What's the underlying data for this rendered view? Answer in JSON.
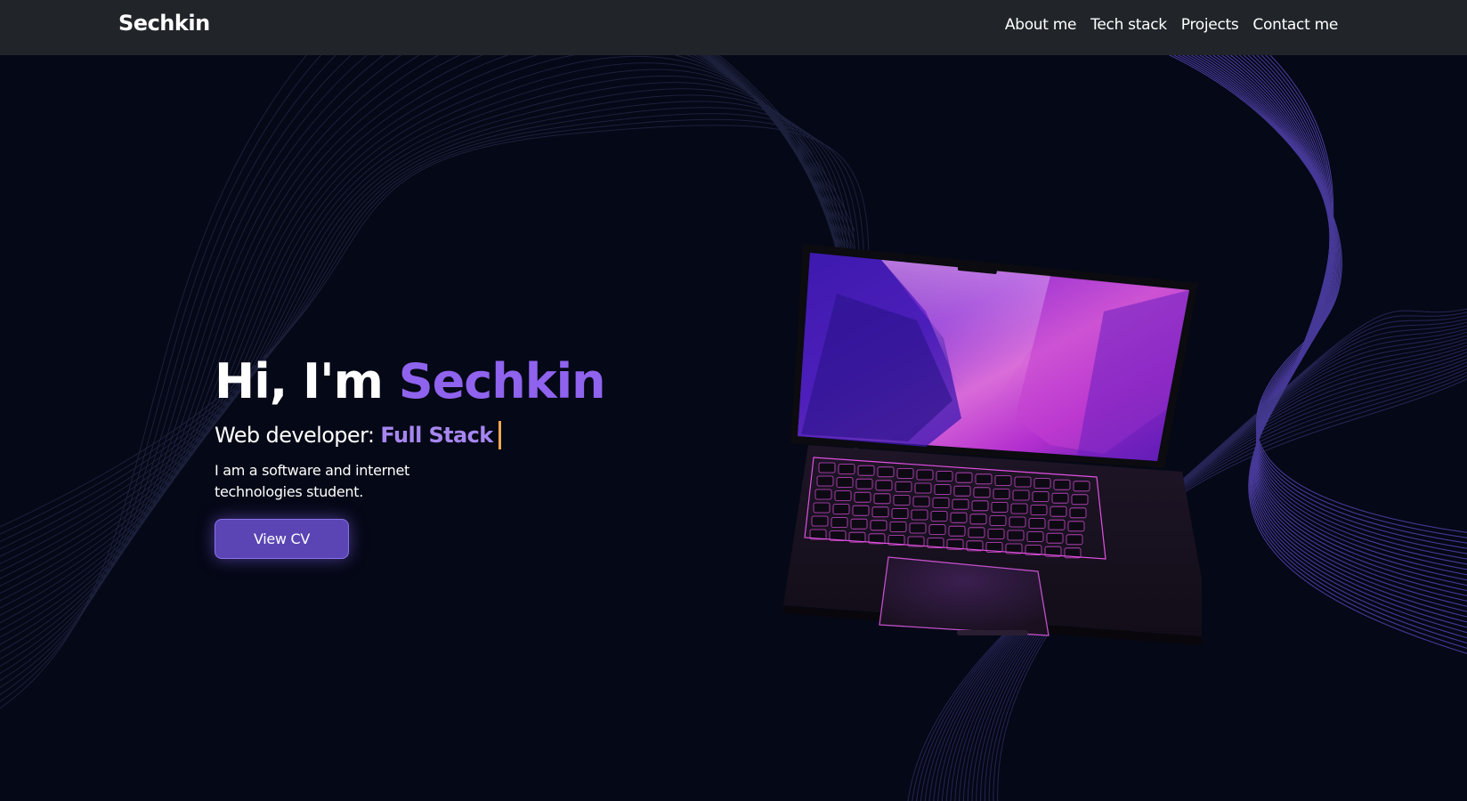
{
  "navbar": {
    "brand": "Sechkin",
    "links": [
      {
        "label": "About me"
      },
      {
        "label": "Tech stack"
      },
      {
        "label": "Projects"
      },
      {
        "label": "Contact me"
      }
    ]
  },
  "hero": {
    "greeting": "Hi, I'm",
    "name": "Sechkin",
    "role_prefix": "Web developer:",
    "role_highlight": "Full Stack",
    "description": "I am a software and internet technologies student.",
    "cv_button": "View CV"
  },
  "colors": {
    "background": "#050816",
    "navbar": "#212529",
    "accent": "#8f63ee",
    "accent_light": "#a686f0",
    "button": "#5b45b4",
    "caret": "#f0a94a"
  },
  "icons": {
    "laptop": "laptop-illustration",
    "background": "wavy-lines-pattern"
  }
}
